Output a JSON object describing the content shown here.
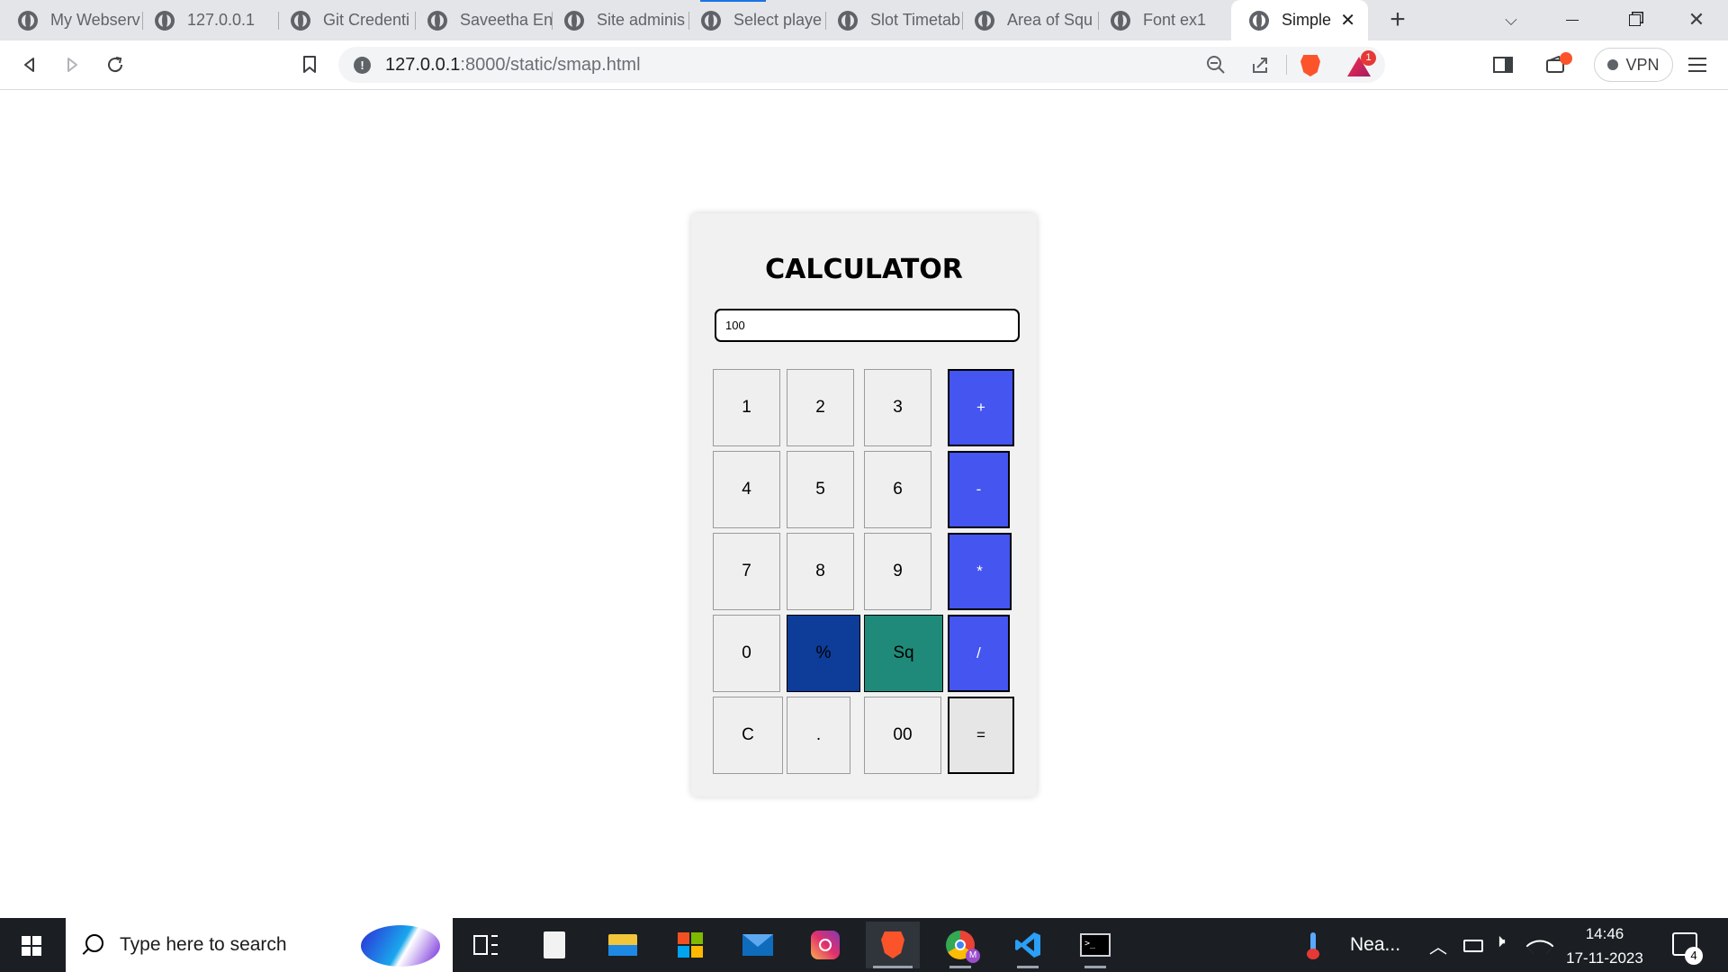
{
  "browser": {
    "tabs": [
      {
        "title": "My Webserv"
      },
      {
        "title": "127.0.0.1"
      },
      {
        "title": "Git Credenti"
      },
      {
        "title": "Saveetha En"
      },
      {
        "title": "Site adminis"
      },
      {
        "title": "Select playe"
      },
      {
        "title": "Slot Timetab"
      },
      {
        "title": "Area of Squ"
      },
      {
        "title": "Font ex1"
      },
      {
        "title": "Simple",
        "active": true
      }
    ],
    "new_tab_label": "+",
    "url_host": "127.0.0.1",
    "url_rest": ":8000/static/smap.html",
    "bat_badge": "1",
    "vpn_label": "VPN"
  },
  "calculator": {
    "title": "CALCULATOR",
    "display_value": "100",
    "keys": {
      "k1": "1",
      "k2": "2",
      "k3": "3",
      "plus": "+",
      "k4": "4",
      "k5": "5",
      "k6": "6",
      "minus": "-",
      "k7": "7",
      "k8": "8",
      "k9": "9",
      "multiply": "*",
      "k0": "0",
      "percent": "%",
      "square": "Sq",
      "divide": "/",
      "clear": "C",
      "dot": ".",
      "k00": "00",
      "equals": "="
    },
    "colors": {
      "operator": "#4455f0",
      "percent": "#0d3c99",
      "square": "#1f8a7a",
      "key": "#efefef",
      "panel": "#f1f1f1"
    }
  },
  "taskbar": {
    "search_placeholder": "Type here to search",
    "weather_text": "Nea...",
    "time": "14:46",
    "date": "17-11-2023",
    "notification_count": "4"
  }
}
